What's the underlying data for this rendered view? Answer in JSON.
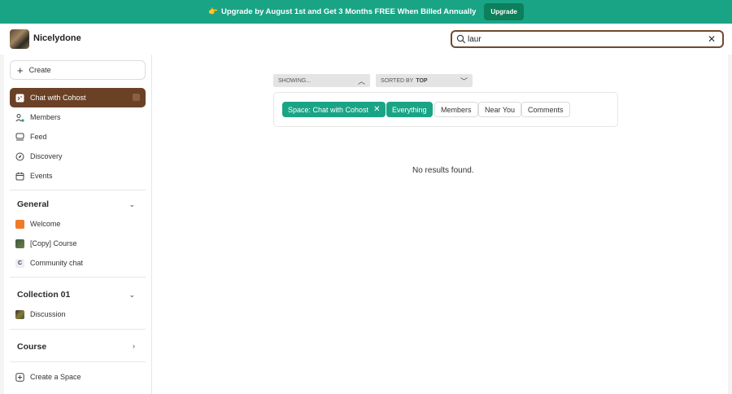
{
  "banner": {
    "emoji": "👉",
    "text": "Upgrade by August 1st and Get 3 Months FREE When Billed Annually",
    "button_label": "Upgrade",
    "color": "#1aa486"
  },
  "header": {
    "brand": "Nicelydone",
    "search": {
      "value": "laur",
      "placeholder": ""
    }
  },
  "sidebar": {
    "create_label": "Create",
    "items": [
      {
        "label": "Chat with Cohost",
        "icon": "chat-icon",
        "active": true
      },
      {
        "label": "Members",
        "icon": "members-icon"
      },
      {
        "label": "Feed",
        "icon": "feed-icon"
      },
      {
        "label": "Discovery",
        "icon": "compass-icon"
      },
      {
        "label": "Events",
        "icon": "calendar-icon"
      }
    ],
    "sections": [
      {
        "title": "General",
        "items": [
          {
            "label": "Welcome",
            "icon": "welcome-icon"
          },
          {
            "label": "[Copy] Course",
            "icon": "course-icon"
          },
          {
            "label": "Community chat",
            "icon": "community-icon",
            "glyph": "C"
          }
        ]
      },
      {
        "title": "Collection 01",
        "items": [
          {
            "label": "Discussion",
            "icon": "discussion-icon"
          }
        ]
      },
      {
        "title": "Course",
        "items": []
      }
    ],
    "footer_items": [
      {
        "label": "Create a Space",
        "icon": "add-square-icon"
      }
    ],
    "accent": "#6b4126"
  },
  "main": {
    "showing_label": "SHOWING...",
    "sorted_prefix": "SORTED BY",
    "sorted_value": "TOP",
    "filter_space": "Space: Chat with Cohost",
    "filters": [
      "Everything",
      "Members",
      "Near You",
      "Comments"
    ],
    "active_filter": "Everything",
    "empty_message": "No results found."
  }
}
